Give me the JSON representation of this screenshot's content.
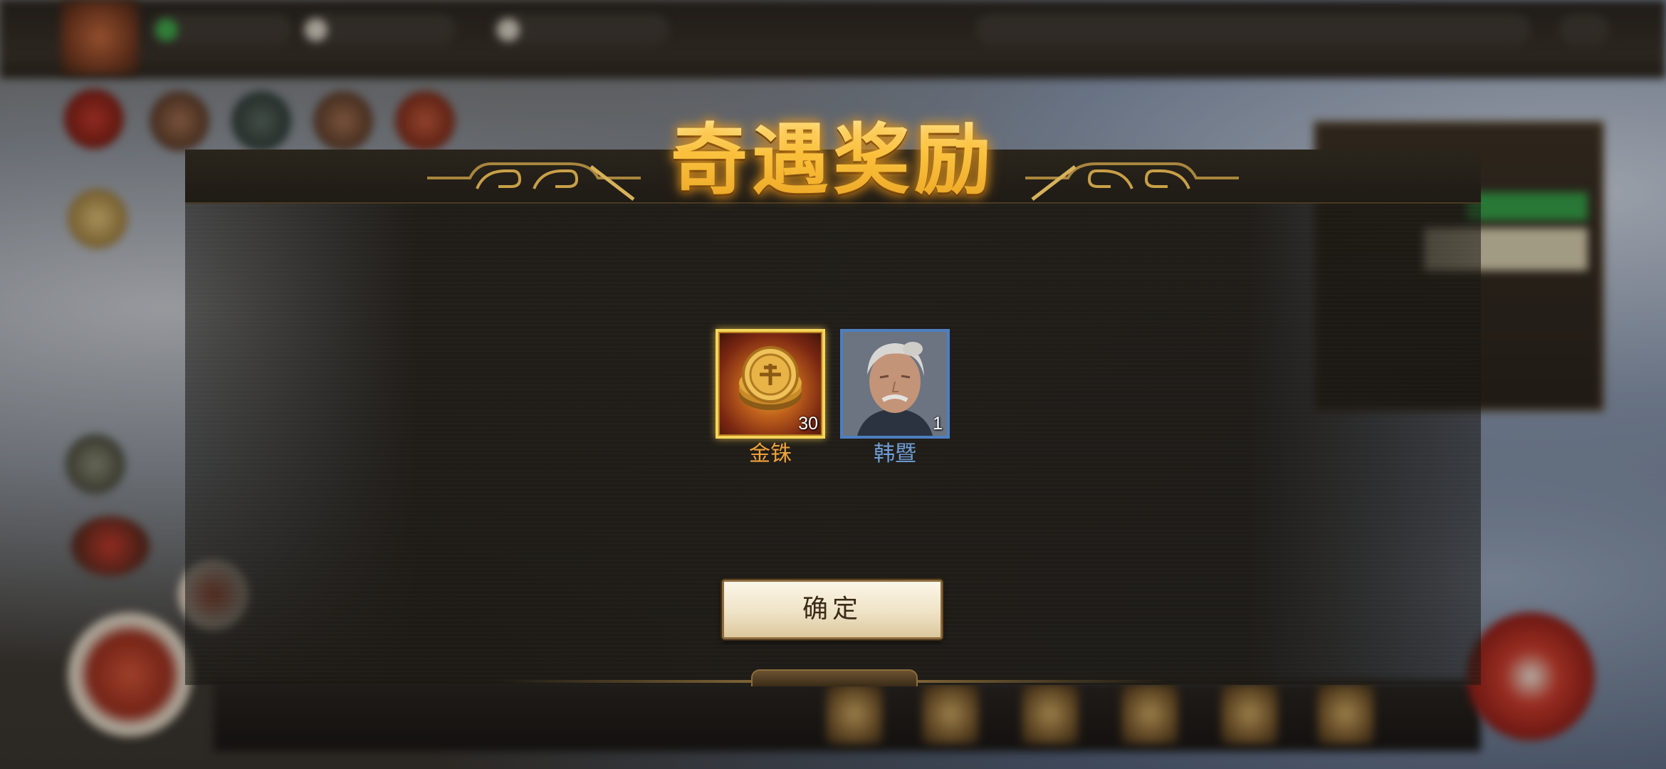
{
  "modal": {
    "title": "奇遇奖励",
    "confirm_label": "确定",
    "rewards": [
      {
        "name": "金铢",
        "count": "30",
        "icon": "gold-coin-icon",
        "rarity_color": "#f5d55a"
      },
      {
        "name": "韩暨",
        "count": "1",
        "icon": "general-portrait",
        "rarity_color": "#4c7fc2"
      }
    ]
  },
  "colors": {
    "title_gold": "#fbd56a",
    "gold_name": "#f0a23a",
    "blue_name": "#6f9ed9"
  }
}
